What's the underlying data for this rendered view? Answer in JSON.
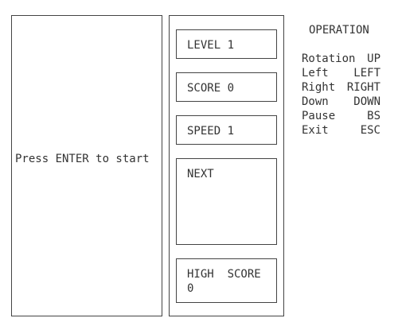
{
  "board": {
    "message": "Press ENTER to start"
  },
  "panel": {
    "level_label": "LEVEL 1",
    "score_label": "SCORE 0",
    "speed_label": "SPEED 1",
    "next_label": "NEXT",
    "high_score_label": "HIGH  SCORE",
    "high_score_value": "0"
  },
  "operation": {
    "title": "OPERATION",
    "controls": [
      {
        "action": "Rotation",
        "key": "UP"
      },
      {
        "action": "Left",
        "key": "LEFT"
      },
      {
        "action": "Right",
        "key": "RIGHT"
      },
      {
        "action": "Down",
        "key": "DOWN"
      },
      {
        "action": "Pause",
        "key": "BS"
      },
      {
        "action": "Exit",
        "key": "ESC"
      }
    ]
  }
}
